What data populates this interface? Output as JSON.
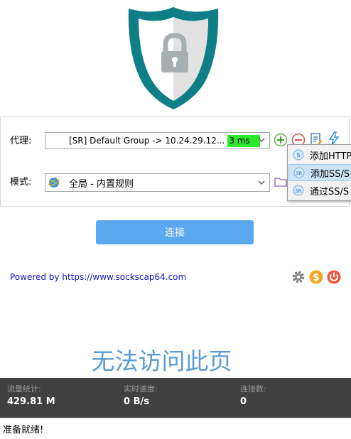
{
  "proxy": {
    "label": "代理:",
    "value": "[SR] Default Group -> 10.24.29.12...",
    "latency": "3 ms",
    "latency_color": "#2ee82e"
  },
  "mode": {
    "label": "模式:",
    "value": "全局 - 内置规则"
  },
  "menu": {
    "items": [
      {
        "label": "添加HTTP",
        "badge": "S",
        "icon": "s-badge-icon"
      },
      {
        "label": "添加SS/S",
        "badge": "SR",
        "icon": "sr-badge-icon"
      },
      {
        "label": "通过SS/S",
        "badge": "SR",
        "icon": "sr-badge-icon"
      }
    ]
  },
  "connect_label": "连接",
  "powered_by": "Powered by https://www.sockscap64.com",
  "error_page": "无法访问此页",
  "stats": {
    "traffic_label": "流量统计:",
    "traffic_value": "429.81 M",
    "speed_label": "实时速度:",
    "speed_value": "0 B/s",
    "connections_label": "连接数:",
    "connections_value": "0"
  },
  "status": "准备就绪!",
  "colors": {
    "accent": "#5aa8ef",
    "shield": "#0e7f86",
    "stats_bg": "#404040",
    "link": "#1515c8"
  }
}
